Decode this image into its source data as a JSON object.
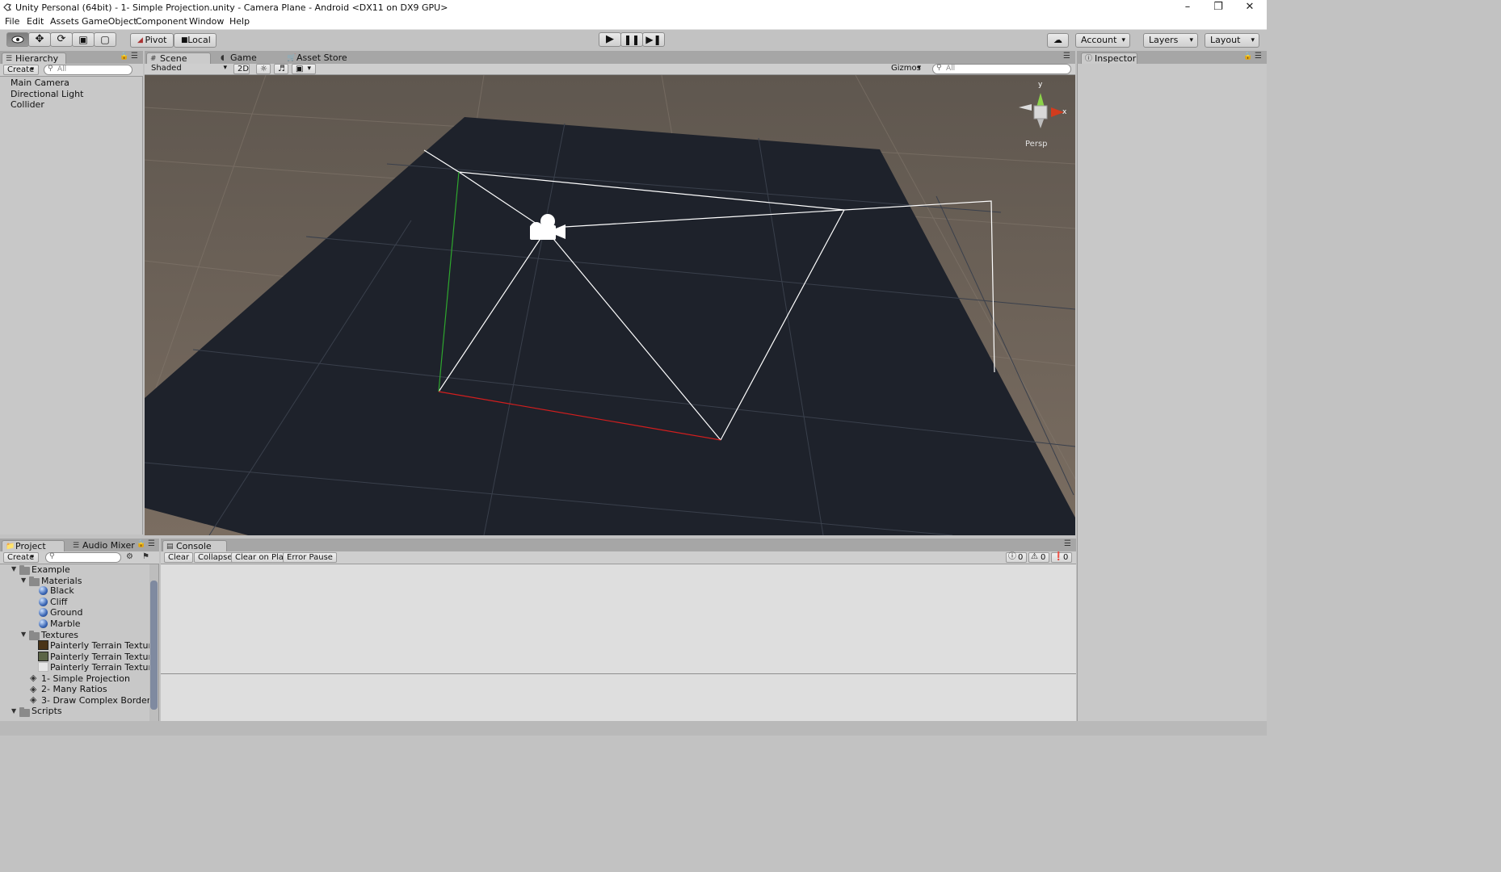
{
  "window": {
    "title": "Unity Personal (64bit) - 1- Simple Projection.unity - Camera Plane - Android <DX11 on DX9 GPU>"
  },
  "menu": [
    "File",
    "Edit",
    "Assets",
    "GameObject",
    "Component",
    "Window",
    "Help"
  ],
  "toolbar": {
    "pivot_label": "Pivot",
    "local_label": "Local",
    "account_label": "Account",
    "layers_label": "Layers",
    "layout_label": "Layout"
  },
  "hierarchy": {
    "tab_label": "Hierarchy",
    "create_label": "Create",
    "search_placeholder": "All",
    "items": [
      "Main Camera",
      "Directional Light",
      "Collider"
    ]
  },
  "scene": {
    "tabs": [
      "Scene",
      "Game",
      "Asset Store"
    ],
    "shading_mode": "Shaded",
    "mode_2d": "2D",
    "gizmos_label": "Gizmos",
    "search_placeholder": "All",
    "gizmo_y": "y",
    "gizmo_x": "x",
    "projection": "Persp"
  },
  "inspector": {
    "tab_label": "Inspector"
  },
  "project": {
    "tabs": [
      "Project",
      "Audio Mixer"
    ],
    "create_label": "Create",
    "tree": {
      "example": "Example",
      "materials": "Materials",
      "material_items": [
        "Black",
        "Cliff",
        "Ground",
        "Marble"
      ],
      "textures": "Textures",
      "texture_items": [
        "Painterly Terrain Texture",
        "Painterly Terrain Texture",
        "Painterly Terrain Texture"
      ],
      "scenes": [
        "1- Simple Projection",
        "2- Many Ratios",
        "3- Draw Complex Borders"
      ],
      "scripts": "Scripts"
    }
  },
  "console": {
    "tab_label": "Console",
    "clear_label": "Clear",
    "collapse_label": "Collapse",
    "clear_on_play_label": "Clear on Play",
    "error_pause_label": "Error Pause",
    "info_count": "0",
    "warning_count": "0",
    "error_count": "0"
  },
  "colors": {
    "editor_bg": "#c2c2c2",
    "plane": "#1e222b",
    "ground": "#6e655c",
    "frustum": "#ffffff",
    "axis_red": "#d21e1e",
    "axis_green": "#2ea82e"
  }
}
